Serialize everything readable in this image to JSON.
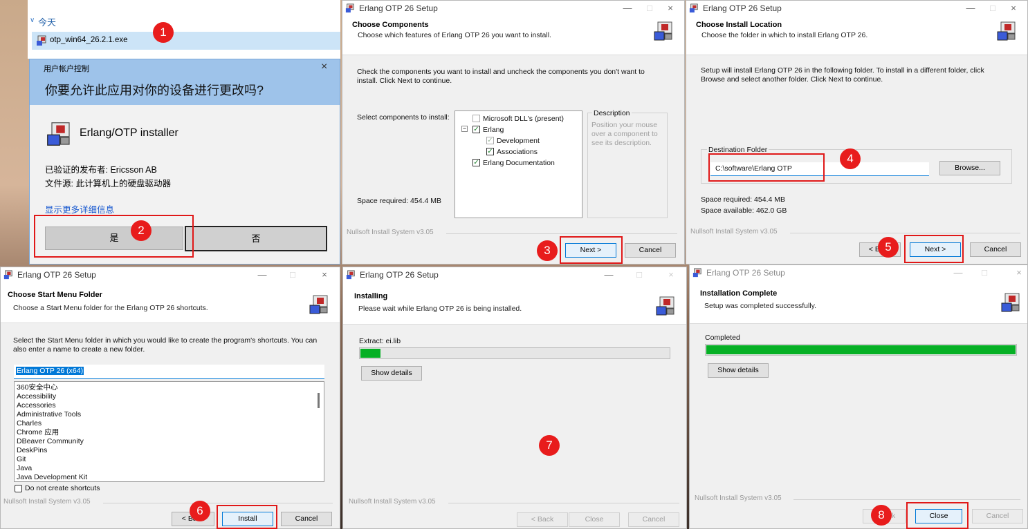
{
  "explorer": {
    "group": "今天",
    "file": "otp_win64_26.2.1.exe"
  },
  "uac": {
    "caption": "用户帐户控制",
    "question": "你要允许此应用对你的设备进行更改吗?",
    "app": "Erlang/OTP installer",
    "publisher": "已验证的发布者: Ericsson AB",
    "origin": "文件源: 此计算机上的硬盘驱动器",
    "more": "显示更多详细信息",
    "yes": "是",
    "no": "否"
  },
  "setup_title": "Erlang OTP 26 Setup",
  "nsis": "Nullsoft Install System v3.05",
  "components": {
    "h1": "Choose Components",
    "h2": "Choose which features of Erlang OTP 26 you want to install.",
    "intro": "Check the components you want to install and uncheck the components you don't want to install. Click Next to continue.",
    "select_label": "Select components to install:",
    "items": [
      "Microsoft DLL's (present)",
      "Erlang",
      "Development",
      "Associations",
      "Erlang Documentation"
    ],
    "desc_title": "Description",
    "desc_text": "Position your mouse over a component to see its description.",
    "space": "Space required: 454.4 MB",
    "next": "Next >",
    "cancel": "Cancel"
  },
  "location": {
    "h1": "Choose Install Location",
    "h2": "Choose the folder in which to install Erlang OTP 26.",
    "intro": "Setup will install Erlang OTP 26 in the following folder. To install in a different folder, click Browse and select another folder. Click Next to continue.",
    "dest_label": "Destination Folder",
    "path": "C:\\software\\Erlang OTP",
    "browse": "Browse...",
    "space_req": "Space required: 454.4 MB",
    "space_avail": "Space available: 462.0 GB",
    "back": "< Back",
    "next": "Next >",
    "cancel": "Cancel"
  },
  "startmenu": {
    "h1": "Choose Start Menu Folder",
    "h2": "Choose a Start Menu folder for the Erlang OTP 26 shortcuts.",
    "intro": "Select the Start Menu folder in which you would like to create the program's shortcuts. You can also enter a name to create a new folder.",
    "folder": "Erlang OTP 26 (x64)",
    "items": [
      "360安全中心",
      "Accessibility",
      "Accessories",
      "Administrative Tools",
      "Charles",
      "Chrome 应用",
      "DBeaver Community",
      "DeskPins",
      "Git",
      "Java",
      "Java Development Kit"
    ],
    "no_shortcuts": "Do not create shortcuts",
    "back": "< Back",
    "install": "Install",
    "cancel": "Cancel"
  },
  "installing": {
    "h1": "Installing",
    "h2": "Please wait while Erlang OTP 26 is being installed.",
    "extract": "Extract: ei.lib",
    "progress": 0.065,
    "details": "Show details",
    "back": "< Back",
    "close": "Close",
    "cancel": "Cancel"
  },
  "complete": {
    "h1": "Installation Complete",
    "h2": "Setup was completed successfully.",
    "status": "Completed",
    "progress": 1.0,
    "details": "Show details",
    "back": "< Back",
    "close": "Close",
    "cancel": "Cancel"
  },
  "steps": [
    "1",
    "2",
    "3",
    "4",
    "5",
    "6",
    "7",
    "8"
  ],
  "colors": {
    "annotation": "#e81c1c",
    "progress": "#06b025",
    "uac_header": "#9ec3ea"
  }
}
